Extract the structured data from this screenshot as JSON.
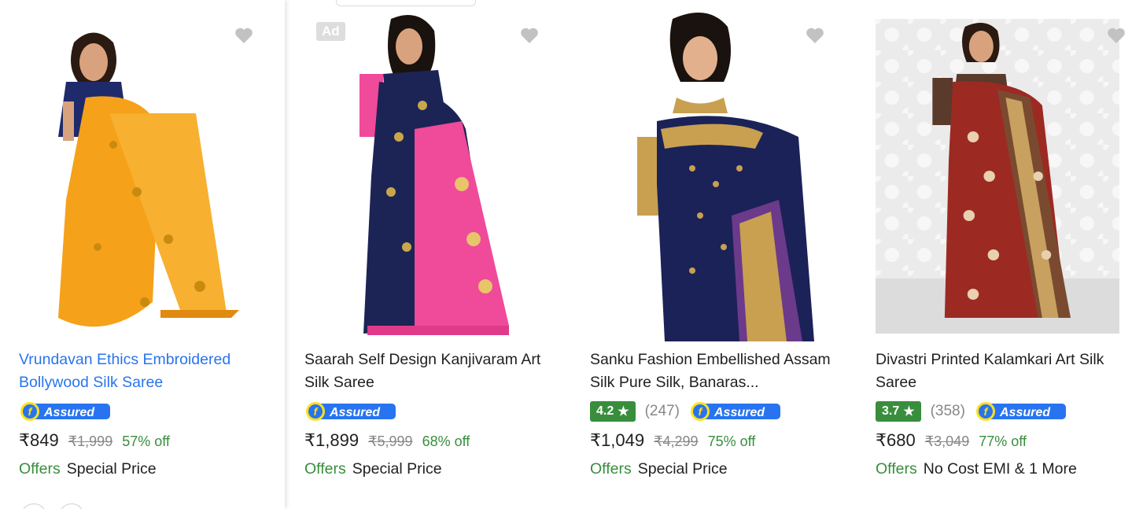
{
  "products": [
    {
      "title": "Vrundavan Ethics Embroidered Bollywood Silk Saree",
      "assured": "Assured",
      "price": "₹849",
      "mrp": "₹1,999",
      "off": "57% off",
      "offers_label": "Offers",
      "offers_text": "Special Price",
      "image": "orange-silk-saree-model",
      "colors": {
        "primary": "#f5a11a",
        "secondary": "#1f2a6b",
        "skin": "#d9a27e"
      }
    },
    {
      "ad": "Ad",
      "title": "Saarah Self Design Kanjivaram Art Silk Saree",
      "assured": "Assured",
      "price": "₹1,899",
      "mrp": "₹5,999",
      "off": "68% off",
      "offers_label": "Offers",
      "offers_text": "Special Price",
      "image": "navy-pink-kanjivaram-saree-model",
      "colors": {
        "primary": "#1c2456",
        "secondary": "#f04a9a",
        "skin": "#d9a27e"
      }
    },
    {
      "title": "Sanku Fashion Embellished Assam Silk Pure Silk, Banaras...",
      "rating": "4.2",
      "rating_count": "(247)",
      "assured": "Assured",
      "price": "₹1,049",
      "mrp": "₹4,299",
      "off": "75% off",
      "offers_label": "Offers",
      "offers_text": "Special Price",
      "image": "navy-gold-banarasi-saree-model",
      "colors": {
        "primary": "#1b2258",
        "secondary": "#c8a050",
        "skin": "#e2b08c"
      }
    },
    {
      "title": "Divastri Printed Kalamkari Art Silk Saree",
      "rating": "3.7",
      "rating_count": "(358)",
      "assured": "Assured",
      "price": "₹680",
      "mrp": "₹3,049",
      "off": "77% off",
      "offers_label": "Offers",
      "offers_text": "No Cost EMI & 1 More",
      "image": "red-kalamkari-saree-model",
      "colors": {
        "primary": "#9c2a22",
        "secondary": "#5a3a2a",
        "skin": "#d9a27e"
      }
    }
  ],
  "icons": {
    "wishlist": "heart-icon",
    "rating_star": "star-icon",
    "assured": "flipkart-assured-icon"
  },
  "theme": {
    "link": "#2874f0",
    "green": "#388e3c",
    "muted": "#878787",
    "assured_blue": "#2874f0",
    "assured_yellow": "#ffe11b"
  }
}
